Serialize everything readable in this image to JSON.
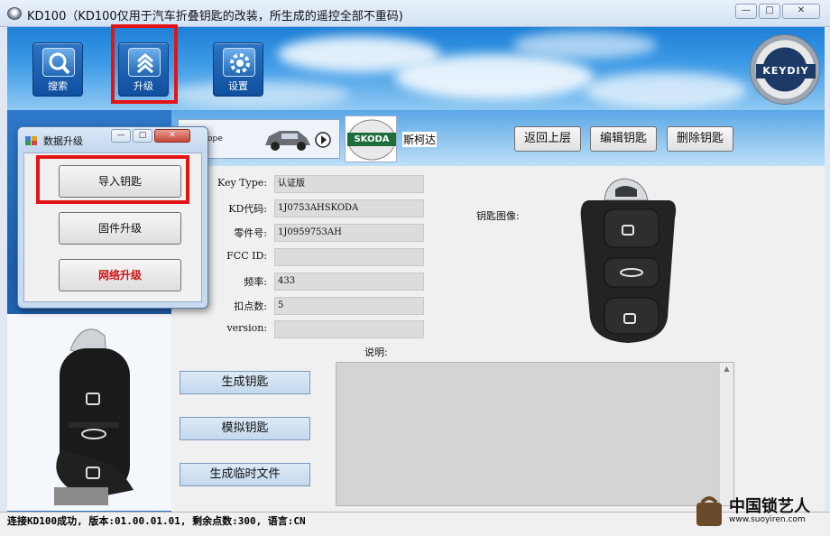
{
  "window": {
    "title": "KD100（KD100仅用于汽车折叠钥匙的改装，所生成的遥控全部不重码)",
    "min": "—",
    "max": "□",
    "close": "✕"
  },
  "toolbar": {
    "search_label": "搜索",
    "upgrade_label": "升级",
    "settings_label": "设置"
  },
  "logo_text": "KEYDIY",
  "vehicle": {
    "model_fragment": "ope",
    "brand_logo_text": "SKODA",
    "brand_name": "斯柯达"
  },
  "actions": {
    "back": "返回上层",
    "edit": "编辑钥匙",
    "delete": "删除钥匙"
  },
  "fields": [
    {
      "label": "Key Type:",
      "value": "认证版"
    },
    {
      "label": "KD代码:",
      "value": "1J0753AHSKODA"
    },
    {
      "label": "零件号:",
      "value": "1J0959753AH"
    },
    {
      "label": "FCC ID:",
      "value": ""
    },
    {
      "label": "频率:",
      "value": "433"
    },
    {
      "label": "扣点数:",
      "value": "5"
    },
    {
      "label": "version:",
      "value": ""
    }
  ],
  "key_image_label": "钥匙图像:",
  "notes_label": "说明:",
  "buttons": {
    "generate": "生成钥匙",
    "simulate": "模拟钥匙",
    "temp_file": "生成临时文件"
  },
  "dialog": {
    "title": "数据升级",
    "import_keys": "导入钥匙",
    "firmware_upgrade": "固件升级",
    "network_upgrade": "网络升级"
  },
  "status_text": "连接KD100成功, 版本:01.00.01.01, 剩余点数:300, 语言:CN",
  "watermark": {
    "text": "中国锁艺人",
    "url": "www.suoyiren.com"
  },
  "colors": {
    "highlight_red": "#e41414",
    "banner_blue": "#1d7fd6",
    "network_upgrade_text": "#d01010"
  }
}
